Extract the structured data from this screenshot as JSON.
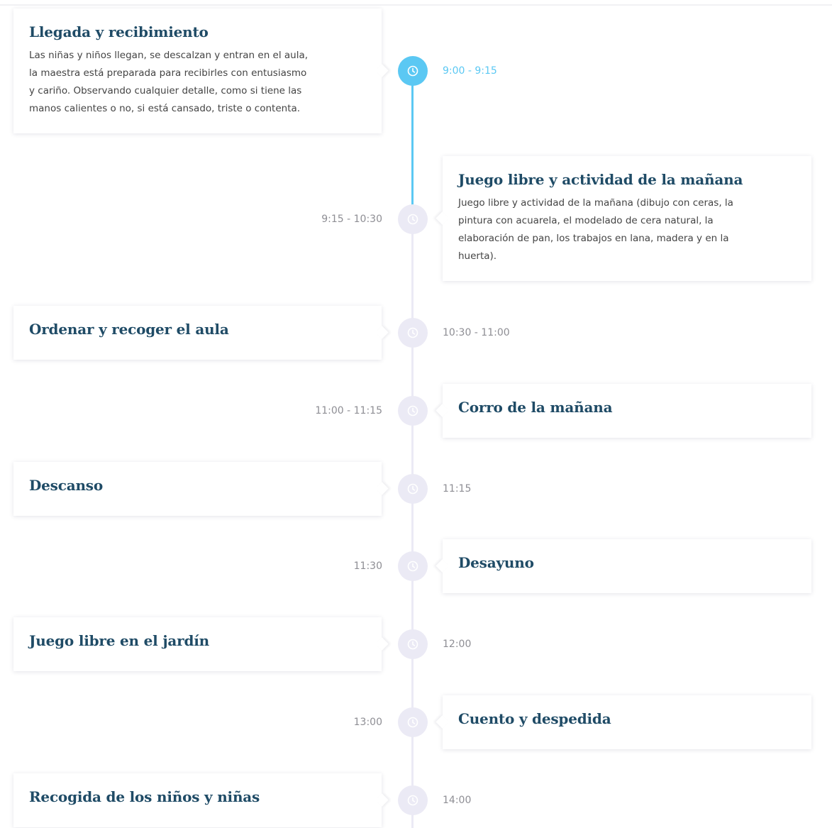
{
  "colors": {
    "accent": "#5bc8f3",
    "line": "#ebeaf5",
    "title": "#1f4b66",
    "time": "#8e8e94"
  },
  "timeline": {
    "progress_fraction": 0.2,
    "items": [
      {
        "title": "Llegada y recibimiento",
        "description_lines": [
          "Las niñas y niños llegan, se descalzan y entran en el aula,",
          "la maestra está preparada para recibirles con entusiasmo",
          "y cariño. Observando cualquier detalle, como si tiene las",
          "manos calientes o no, si está cansado, triste o contenta."
        ],
        "time": "9:00 - 9:15",
        "active": true,
        "icon": "clock-icon"
      },
      {
        "title": "Juego libre y actividad de la mañana",
        "description_lines": [
          "Juego libre y actividad de la mañana (dibujo con ceras, la",
          "pintura con acuarela, el modelado de cera natural, la",
          "elaboración de pan, los trabajos en lana, madera y en la",
          "huerta)."
        ],
        "time": "9:15 - 10:30",
        "active": false,
        "icon": "clock-icon"
      },
      {
        "title": "Ordenar y recoger el aula",
        "time": "10:30 - 11:00",
        "active": false,
        "icon": "clock-icon"
      },
      {
        "title": "Corro de la mañana",
        "time": "11:00 - 11:15",
        "active": false,
        "icon": "clock-icon"
      },
      {
        "title": "Descanso",
        "time": "11:15",
        "active": false,
        "icon": "clock-icon"
      },
      {
        "title": "Desayuno",
        "time": "11:30",
        "active": false,
        "icon": "clock-icon"
      },
      {
        "title": "Juego libre en el jardín",
        "time": "12:00",
        "active": false,
        "icon": "clock-icon"
      },
      {
        "title": "Cuento y despedida",
        "time": "13:00",
        "active": false,
        "icon": "clock-icon"
      },
      {
        "title": "Recogida de los niños y niñas",
        "time": "14:00",
        "active": false,
        "icon": "clock-icon"
      }
    ]
  }
}
